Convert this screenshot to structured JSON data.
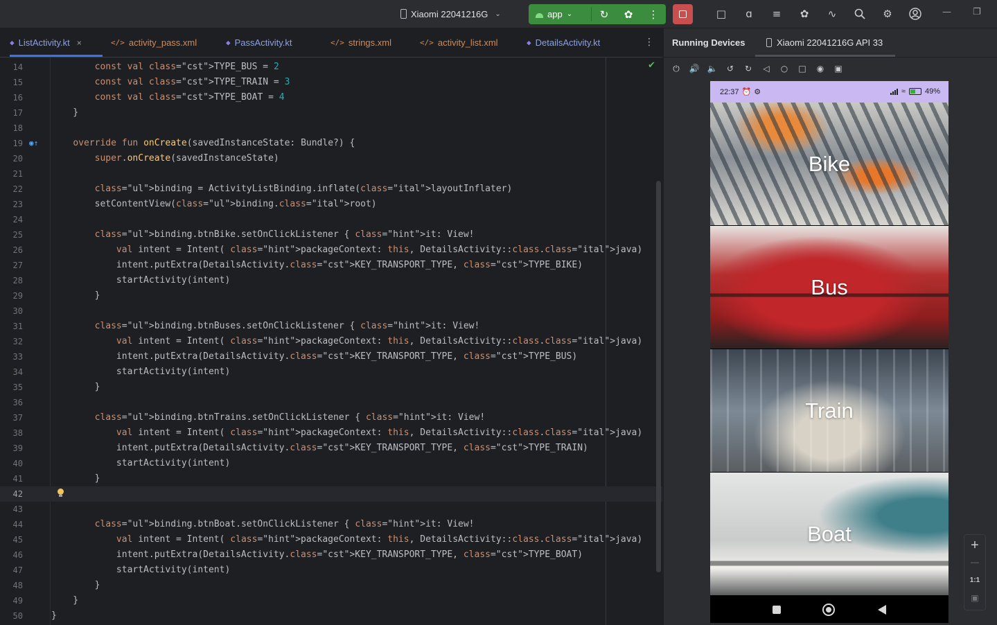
{
  "titlebar": {
    "device_label": "Xiaomi 22041216G",
    "run_config": "app",
    "icons": [
      "rerun-icon",
      "debug-icon",
      "more-vert-icon",
      "stop-icon",
      "device-manager-icon",
      "translate-icon",
      "logcat-icon",
      "inspector-icon",
      "profiler-icon",
      "search-icon",
      "settings-icon",
      "account-icon",
      "minimize-icon",
      "restore-icon"
    ]
  },
  "tabs": [
    {
      "label": "ListActivity.kt",
      "type": "kt",
      "active": true
    },
    {
      "label": "activity_pass.xml",
      "type": "xml"
    },
    {
      "label": "PassActivity.kt",
      "type": "kt"
    },
    {
      "label": "strings.xml",
      "type": "xml"
    },
    {
      "label": "activity_list.xml",
      "type": "xml"
    },
    {
      "label": "DetailsActivity.kt",
      "type": "kt"
    }
  ],
  "editor": {
    "current_line": 42,
    "lines": [
      {
        "n": "14",
        "code": "        const val TYPE_BUS = 2"
      },
      {
        "n": "15",
        "code": "        const val TYPE_TRAIN = 3"
      },
      {
        "n": "16",
        "code": "        const val TYPE_BOAT = 4"
      },
      {
        "n": "17",
        "code": "    }"
      },
      {
        "n": "18",
        "code": ""
      },
      {
        "n": "19",
        "code": "    override fun onCreate(savedInstanceState: Bundle?) {"
      },
      {
        "n": "20",
        "code": "        super.onCreate(savedInstanceState)"
      },
      {
        "n": "21",
        "code": ""
      },
      {
        "n": "22",
        "code": "        binding = ActivityListBinding.inflate(layoutInflater)"
      },
      {
        "n": "23",
        "code": "        setContentView(binding.root)"
      },
      {
        "n": "24",
        "code": ""
      },
      {
        "n": "25",
        "code": "        binding.btnBike.setOnClickListener { it: View!"
      },
      {
        "n": "26",
        "code": "            val intent = Intent( packageContext: this, DetailsActivity::class.java)"
      },
      {
        "n": "27",
        "code": "            intent.putExtra(DetailsActivity.KEY_TRANSPORT_TYPE, TYPE_BIKE)"
      },
      {
        "n": "28",
        "code": "            startActivity(intent)"
      },
      {
        "n": "29",
        "code": "        }"
      },
      {
        "n": "30",
        "code": ""
      },
      {
        "n": "31",
        "code": "        binding.btnBuses.setOnClickListener { it: View!"
      },
      {
        "n": "32",
        "code": "            val intent = Intent( packageContext: this, DetailsActivity::class.java)"
      },
      {
        "n": "33",
        "code": "            intent.putExtra(DetailsActivity.KEY_TRANSPORT_TYPE, TYPE_BUS)"
      },
      {
        "n": "34",
        "code": "            startActivity(intent)"
      },
      {
        "n": "35",
        "code": "        }"
      },
      {
        "n": "36",
        "code": ""
      },
      {
        "n": "37",
        "code": "        binding.btnTrains.setOnClickListener { it: View!"
      },
      {
        "n": "38",
        "code": "            val intent = Intent( packageContext: this, DetailsActivity::class.java)"
      },
      {
        "n": "39",
        "code": "            intent.putExtra(DetailsActivity.KEY_TRANSPORT_TYPE, TYPE_TRAIN)"
      },
      {
        "n": "40",
        "code": "            startActivity(intent)"
      },
      {
        "n": "41",
        "code": "        }"
      },
      {
        "n": "42",
        "code": ""
      },
      {
        "n": "43",
        "code": ""
      },
      {
        "n": "44",
        "code": "        binding.btnBoat.setOnClickListener { it: View!"
      },
      {
        "n": "45",
        "code": "            val intent = Intent( packageContext: this, DetailsActivity::class.java)"
      },
      {
        "n": "46",
        "code": "            intent.putExtra(DetailsActivity.KEY_TRANSPORT_TYPE, TYPE_BOAT)"
      },
      {
        "n": "47",
        "code": "            startActivity(intent)"
      },
      {
        "n": "48",
        "code": "        }"
      },
      {
        "n": "49",
        "code": "    }"
      },
      {
        "n": "50",
        "code": "}"
      }
    ]
  },
  "devices_panel": {
    "title": "Running Devices",
    "device_tab": "Xiaomi 22041216G API 33",
    "toolbar_icons": [
      "power-icon",
      "volume-up-icon",
      "volume-down-icon",
      "rotate-left-icon",
      "rotate-right-icon",
      "back-icon",
      "home-icon",
      "overview-icon",
      "screenshot-icon",
      "screen-record-icon"
    ],
    "zoom": {
      "plus": "+",
      "minus": "—",
      "actual": "1:1"
    }
  },
  "phone": {
    "status_time": "22:37",
    "battery": "49%",
    "status_color": "#c9b8f2",
    "tiles": [
      {
        "label": "Bike"
      },
      {
        "label": "Bus"
      },
      {
        "label": "Train"
      },
      {
        "label": "Boat"
      }
    ]
  }
}
